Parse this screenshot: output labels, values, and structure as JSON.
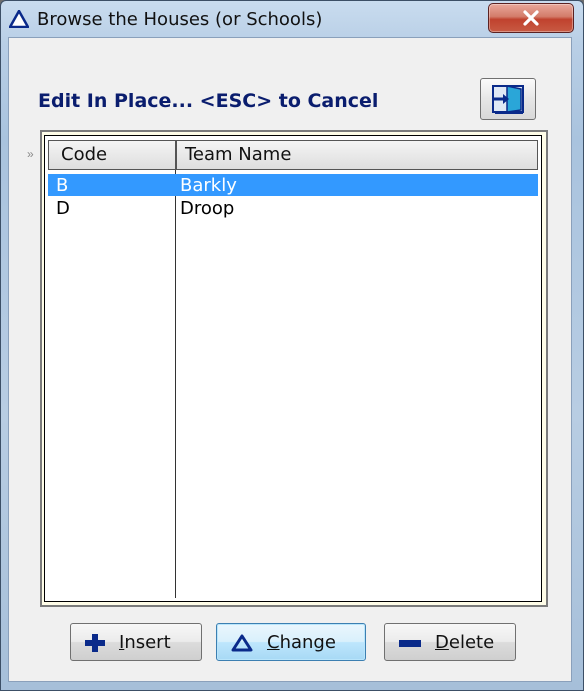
{
  "window": {
    "title": "Browse the Houses (or Schools)",
    "title_icon": "triangle-warning-icon",
    "close_icon": "close-x-icon"
  },
  "heading": "Edit In Place... <ESC> to Cancel",
  "exit_button_icon": "exit-door-icon",
  "row_indicator": "»",
  "grid": {
    "columns": [
      "Code",
      "Team Name"
    ],
    "rows": [
      {
        "code": "B",
        "team_name": "Barkly",
        "selected": true
      },
      {
        "code": "D",
        "team_name": "Droop",
        "selected": false
      }
    ]
  },
  "buttons": {
    "insert": {
      "mnemonic": "I",
      "rest": "nsert",
      "icon": "plus-icon"
    },
    "change": {
      "mnemonic": "C",
      "rest": "hange",
      "icon": "triangle-icon"
    },
    "delete": {
      "mnemonic": "D",
      "rest": "elete",
      "icon": "minus-icon"
    }
  },
  "colors": {
    "selection": "#3399ff",
    "heading": "#0a1d6e",
    "close_button": "#c0422e",
    "icon_blue": "#0a2a8a"
  }
}
